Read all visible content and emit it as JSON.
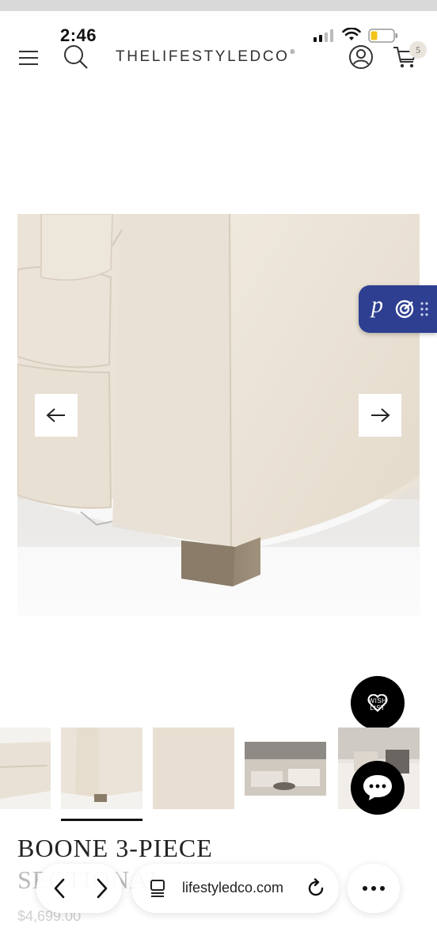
{
  "status_bar": {
    "time": "2:46"
  },
  "header": {
    "brand": "THELIFESTYLEDCO",
    "brand_mark": "®",
    "cart_count": "5"
  },
  "product": {
    "title_line1": "BOONE 3-PIECE",
    "title_line2": "SECTIONAL",
    "price": "$4,699.00"
  },
  "wishlist": {
    "label_line1": "WISH",
    "label_line2": "LIST"
  },
  "plugin": {
    "letter": "p"
  },
  "browser": {
    "address": "lifestyledco.com"
  },
  "colors": {
    "plugin_bg": "#2e3f91",
    "fabric": "#ece4d8",
    "leg": "#8a7c68",
    "black": "#000000"
  },
  "icons": [
    "menu-icon",
    "search-icon",
    "account-icon",
    "cart-icon",
    "arrow-left-icon",
    "arrow-right-icon",
    "heart-icon",
    "chat-icon",
    "back-icon",
    "forward-icon",
    "tabs-icon",
    "reload-icon",
    "more-icon"
  ]
}
